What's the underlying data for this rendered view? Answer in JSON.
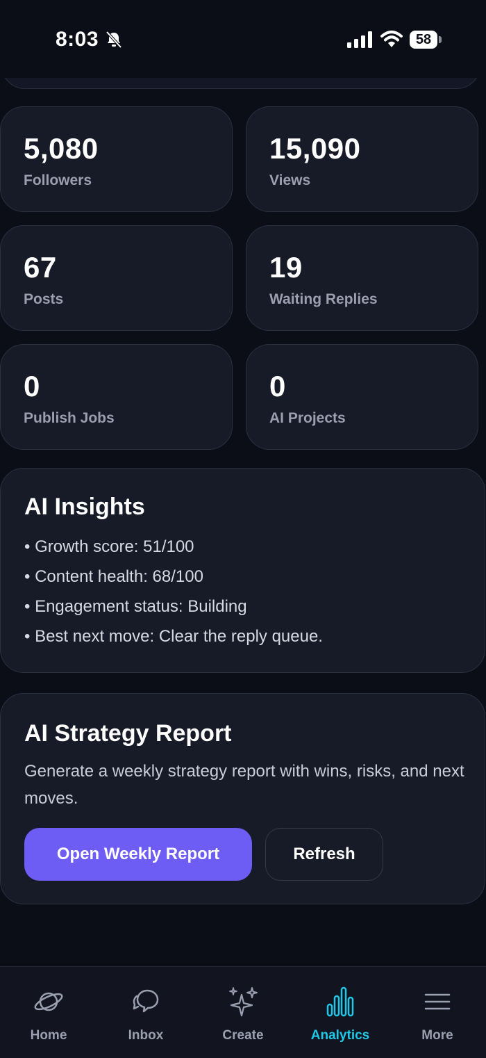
{
  "status_bar": {
    "time": "8:03",
    "battery": "58"
  },
  "stats": [
    {
      "value": "5,080",
      "label": "Followers"
    },
    {
      "value": "15,090",
      "label": "Views"
    },
    {
      "value": "67",
      "label": "Posts"
    },
    {
      "value": "19",
      "label": "Waiting Replies"
    },
    {
      "value": "0",
      "label": "Publish Jobs"
    },
    {
      "value": "0",
      "label": "AI Projects"
    }
  ],
  "insights": {
    "title": "AI Insights",
    "items": [
      "Growth score: 51/100",
      "Content health: 68/100",
      "Engagement status: Building",
      "Best next move: Clear the reply queue."
    ]
  },
  "strategy": {
    "title": "AI Strategy Report",
    "description": "Generate a weekly strategy report with wins, risks, and next moves.",
    "primary_button": "Open Weekly Report",
    "secondary_button": "Refresh"
  },
  "nav": {
    "items": [
      {
        "label": "Home",
        "icon": "planet-icon"
      },
      {
        "label": "Inbox",
        "icon": "chat-bubbles-icon"
      },
      {
        "label": "Create",
        "icon": "sparkles-icon"
      },
      {
        "label": "Analytics",
        "icon": "bar-chart-icon"
      },
      {
        "label": "More",
        "icon": "menu-icon"
      }
    ],
    "active": "Analytics",
    "active_color": "#1ec8e6",
    "inactive_color": "#9aa0b0"
  },
  "colors": {
    "background": "#0b0e16",
    "card": "#171b27",
    "accent": "#6d5df5"
  }
}
